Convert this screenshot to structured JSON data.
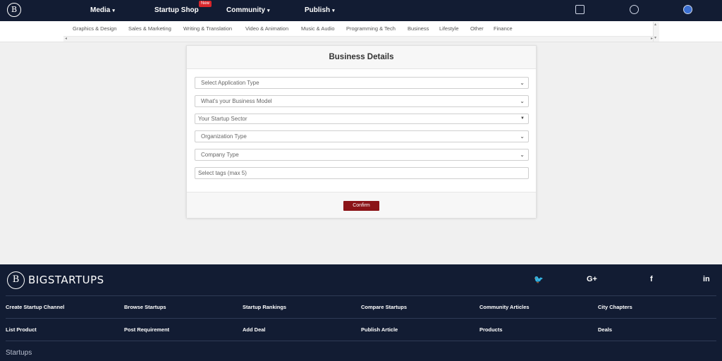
{
  "nav": {
    "logo": "B",
    "items": [
      {
        "label": "Media",
        "caret": "▾"
      },
      {
        "label": "Startup Shop"
      },
      {
        "label": "Community",
        "caret": "▾"
      },
      {
        "label": "Publish",
        "caret": "▾"
      }
    ],
    "new_badge": "New",
    "icons": [
      "startup-shop-icon",
      "chat-icon",
      "user-avatar-icon"
    ]
  },
  "categories": [
    "Graphics & Design",
    "Sales & Marketing",
    "Writing & Translation",
    "Video & Animation",
    "Music & Audio",
    "Programming & Tech",
    "Business",
    "Lifestyle",
    "Other",
    "Finance"
  ],
  "form": {
    "title": "Business Details",
    "fields": [
      {
        "placeholder": "Select Application Type",
        "dropdown": true
      },
      {
        "placeholder": "What's your Business Model",
        "dropdown": true
      },
      {
        "placeholder": "Your Startup Sector",
        "dropdown": true
      },
      {
        "placeholder": "Organization Type",
        "dropdown": true
      },
      {
        "placeholder": "Company Type",
        "dropdown": true
      },
      {
        "placeholder": "Select tags (max 5)",
        "dropdown": false
      }
    ],
    "confirm_label": "Confirm"
  },
  "footer": {
    "logo": "B",
    "brand": "BIGSTARTUPS",
    "social": [
      {
        "name": "twitter-icon",
        "glyph": "🐦"
      },
      {
        "name": "google-plus-icon",
        "glyph": "G+"
      },
      {
        "name": "facebook-icon",
        "glyph": "f"
      },
      {
        "name": "linkedin-icon",
        "glyph": "in"
      }
    ],
    "links_row1": [
      "Create Startup Channel",
      "Browse Startups",
      "Startup Rankings",
      "Compare Startups",
      "Community Articles",
      "City Chapters"
    ],
    "links_row2": [
      "List Product",
      "Post Requirement",
      "Add Deal",
      "Publish Article",
      "Products",
      "Deals"
    ],
    "section": "Startups"
  },
  "colors": {
    "nav_bg": "#121c33",
    "confirm_bg": "#8b1418",
    "badge": "#d9262b"
  }
}
